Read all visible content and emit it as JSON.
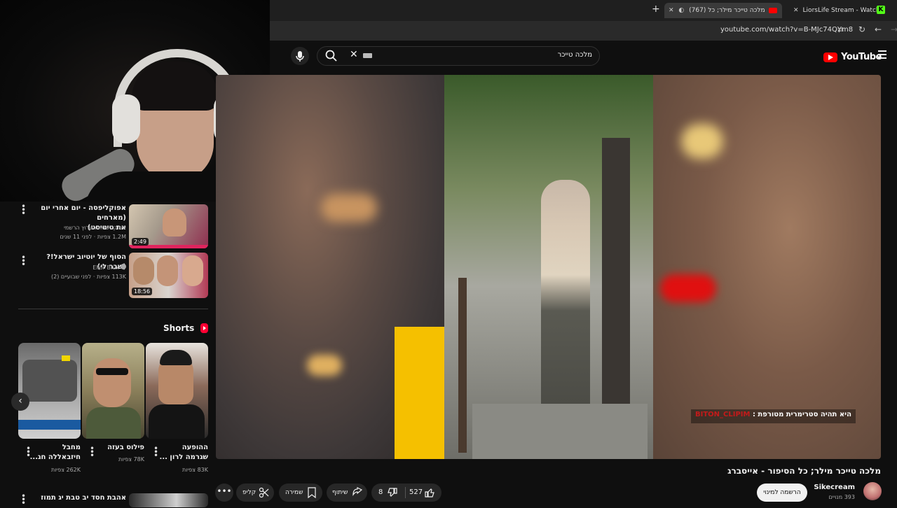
{
  "browser": {
    "tabs": [
      {
        "label": "LiorsLife Stream - Watch Live o"
      },
      {
        "label": "(767) מלכה טייכר מילר; כל"
      }
    ],
    "url": "youtube.com/watch?v=B-MJc74QYm8"
  },
  "masthead": {
    "logo": "YouTube",
    "search_value": "מלכה טייכר"
  },
  "sidebar": {
    "recommendations": [
      {
        "title_line1": "אפוקליפסה - יום אחרי יום (מארחים",
        "title_line2": "את טיטיסט)",
        "channel": "אפוקליפסה הערוץ הרשמי",
        "meta": "1.2M צפיות · לפני 11 שנים",
        "duration": "2:49"
      },
      {
        "title_line1": "הסוף של יוטיוב ישראל!? (שבר לי)",
        "channel": "Elior Blux",
        "meta": "113K צפיות · לפני שבועיים (2)",
        "duration": "18:56"
      }
    ],
    "shorts_label": "Shorts",
    "shorts": [
      {
        "title_line1": "ההופעה",
        "title_line2": "שגרמה לרון ...",
        "views": "83K צפיות"
      },
      {
        "title_line1": "פילוס בעזה",
        "title_line2": "",
        "views": "78K צפיות"
      },
      {
        "title_line1": "מחבל",
        "title_line2": "חיזבאללה חג...",
        "views": "262K צפיות"
      }
    ],
    "bottom_item": "אהבת חסד יב טבת יג תמוז"
  },
  "video": {
    "caption_text": "היא תהיה סטרימרית מטורפת :",
    "caption_tag": "BITON_CLIPIM",
    "title": "מלכה טייכר מילר; כל הסיפור - אייסברג",
    "channel": "Sikecream",
    "subscribers": "393 מנויים",
    "subscribe_label": "הרשמה למינוי",
    "likes": "527",
    "dislikes": "8",
    "share_label": "שיתוף",
    "save_label": "שמירה",
    "clip_label": "קליפ"
  },
  "colors": {
    "brand_red": "#ff0000",
    "bg": "#0f0f0f",
    "pill": "#272727"
  }
}
